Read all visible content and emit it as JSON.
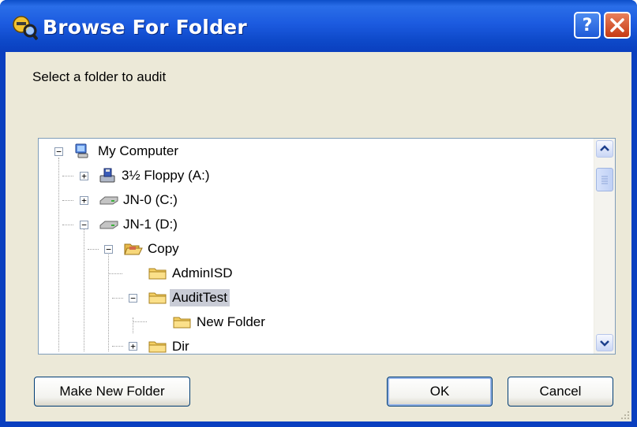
{
  "window": {
    "title": "Browse For Folder"
  },
  "titlebar": {
    "help_label": "?",
    "close_icon": "close-icon",
    "app_icon": "audit-app-icon"
  },
  "instruction": "Select a folder to audit",
  "tree": {
    "items": [
      {
        "label": "My Computer",
        "icon": "computer-icon",
        "expander": "−",
        "selected": false
      },
      {
        "label": "3½ Floppy (A:)",
        "icon": "floppy-drive-icon",
        "expander": "+",
        "selected": false
      },
      {
        "label": "JN-0 (C:)",
        "icon": "hard-drive-icon",
        "expander": "+",
        "selected": false
      },
      {
        "label": "JN-1 (D:)",
        "icon": "hard-drive-icon",
        "expander": "−",
        "selected": false
      },
      {
        "label": "Copy",
        "icon": "open-folder-icon",
        "expander": "−",
        "selected": false
      },
      {
        "label": "AdminISD",
        "icon": "folder-icon",
        "expander": "",
        "selected": false
      },
      {
        "label": "AuditTest",
        "icon": "folder-icon",
        "expander": "−",
        "selected": true
      },
      {
        "label": "New Folder",
        "icon": "folder-icon",
        "expander": "",
        "selected": false
      },
      {
        "label": "Dir",
        "icon": "folder-icon",
        "expander": "+",
        "selected": false
      }
    ]
  },
  "buttons": {
    "make_new_folder": "Make New Folder",
    "ok": "OK",
    "cancel": "Cancel"
  },
  "colors": {
    "titlebar": "#0a3fbf",
    "client": "#ece9d8",
    "selection": "#c9ccd6",
    "close": "#c63a14"
  }
}
